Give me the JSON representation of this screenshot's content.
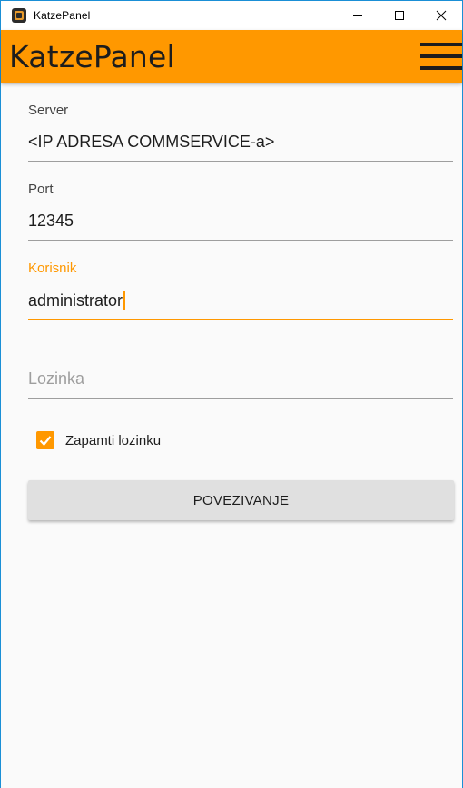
{
  "window": {
    "title": "KatzePanel",
    "icon": "katzepanel-app-icon",
    "controls": [
      "minimize-icon",
      "maximize-icon",
      "close-icon"
    ]
  },
  "appbar": {
    "title": "KatzePanel",
    "menu_icon": "hamburger-menu-icon",
    "color": "#ff9800"
  },
  "form": {
    "server": {
      "label": "Server",
      "value": "<IP ADRESA COMMSERVICE-a>"
    },
    "port": {
      "label": "Port",
      "value": "12345"
    },
    "user": {
      "label": "Korisnik",
      "value": "administrator"
    },
    "password": {
      "placeholder": "Lozinka",
      "value": ""
    },
    "remember": {
      "label": "Zapamti lozinku",
      "checked": true
    },
    "connect_button": "POVEZIVANJE"
  },
  "colors": {
    "accent": "#ff9800",
    "background": "#fafafa",
    "button": "#e0e0e0"
  }
}
